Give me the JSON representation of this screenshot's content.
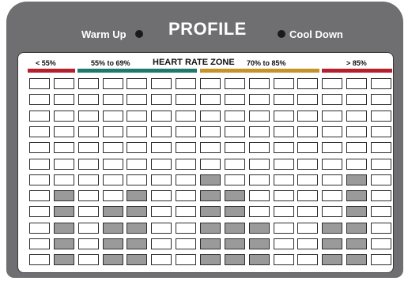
{
  "header": {
    "warm_up": "Warm Up",
    "title": "PROFILE",
    "cool_down": "Cool Down"
  },
  "zones": {
    "title": "HEART RATE ZONE",
    "labels": [
      "< 55%",
      "55% to 69%",
      "70% to 85%",
      "> 85%"
    ],
    "colors": [
      "#b5202e",
      "#1f7a6e",
      "#c4932a",
      "#b5202e"
    ]
  },
  "colors": {
    "console": "#6f6f71",
    "filled_cell": "#9a9a9a"
  },
  "profile_levels": [
    0,
    5,
    0,
    4,
    5,
    0,
    0,
    6,
    5,
    3,
    0,
    0,
    3,
    6,
    0
  ]
}
